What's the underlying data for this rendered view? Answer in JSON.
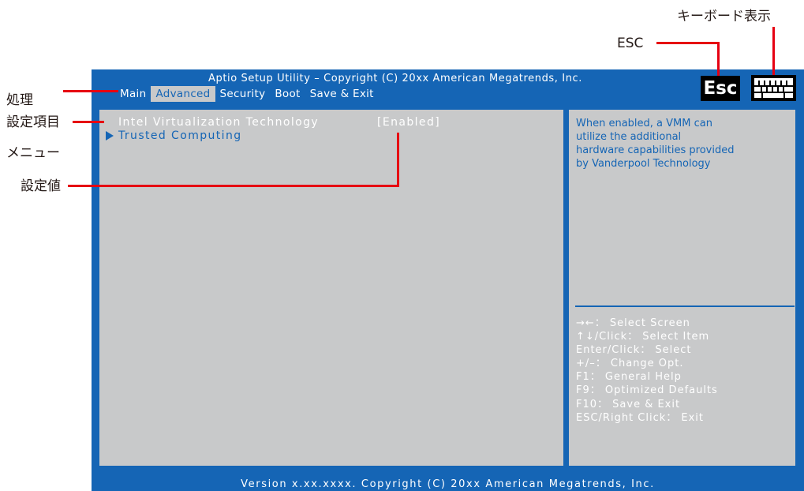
{
  "callouts": {
    "menu_label_line1": "処理",
    "menu_label_line2": "メニュー",
    "item_label": "設定項目",
    "value_label": "設定値",
    "esc_label": "ESC",
    "keyboard_label": "キーボード表示"
  },
  "bios": {
    "title": "Aptio Setup Utility – Copyright (C) 20xx American Megatrends, Inc.",
    "tabs": [
      {
        "label": "Main",
        "active": false
      },
      {
        "label": "Advanced",
        "active": true
      },
      {
        "label": "Security",
        "active": false
      },
      {
        "label": "Boot",
        "active": false
      },
      {
        "label": "Save & Exit",
        "active": false
      }
    ],
    "esc_key": "Esc",
    "settings": {
      "vt_label": "Intel Virtualization Technology",
      "vt_value": "[Enabled]",
      "trusted_label": "Trusted Computing"
    },
    "help_text": "When enabled, a VMM can\nutilize the additional\nhardware capabilities provided\nby Vanderpool Technology",
    "key_help": [
      "→←： Select Screen",
      "↑↓/Click： Select Item",
      "Enter/Click： Select",
      "+/–： Change Opt.",
      "F1： General Help",
      "F9： Optimized Defaults",
      "F10： Save & Exit",
      "ESC/Right Click： Exit"
    ],
    "footer": "Version x.xx.xxxx. Copyright (C) 20xx American Megatrends, Inc."
  },
  "colors": {
    "bios_blue": "#1565b5",
    "panel_gray": "#c8c9ca",
    "callout_red": "#e60012",
    "text_white": "#ffffff"
  }
}
